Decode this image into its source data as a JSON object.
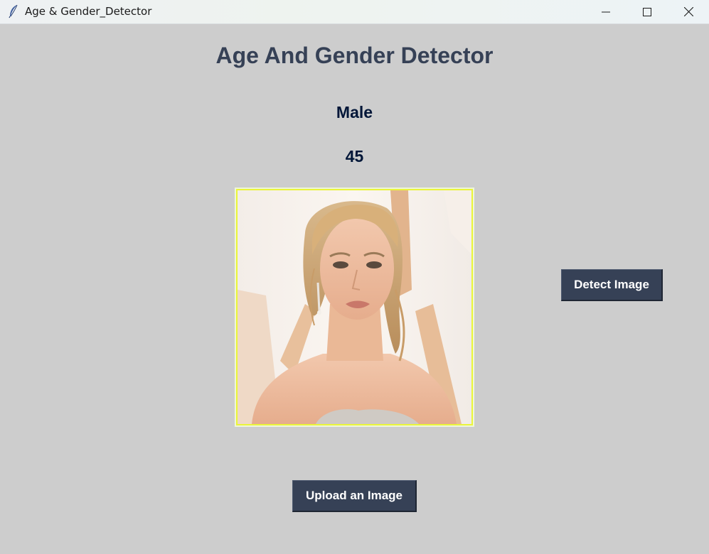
{
  "window": {
    "title": "Age & Gender_Detector",
    "app_icon": "feather-icon",
    "controls": [
      "minimize-icon",
      "maximize-icon",
      "close-icon"
    ]
  },
  "main": {
    "heading": "Age And Gender Detector",
    "gender_result": "Male",
    "age_result": "45",
    "photo": {
      "description_icon": "uploaded-photo",
      "border_color": "#eaf53a"
    },
    "detect_button": "Detect Image",
    "upload_button": "Upload an Image"
  },
  "colors": {
    "background": "#cdcdcd",
    "heading": "#364156",
    "result_text": "#011638",
    "button_bg": "#364156",
    "button_text": "#ffffff"
  }
}
